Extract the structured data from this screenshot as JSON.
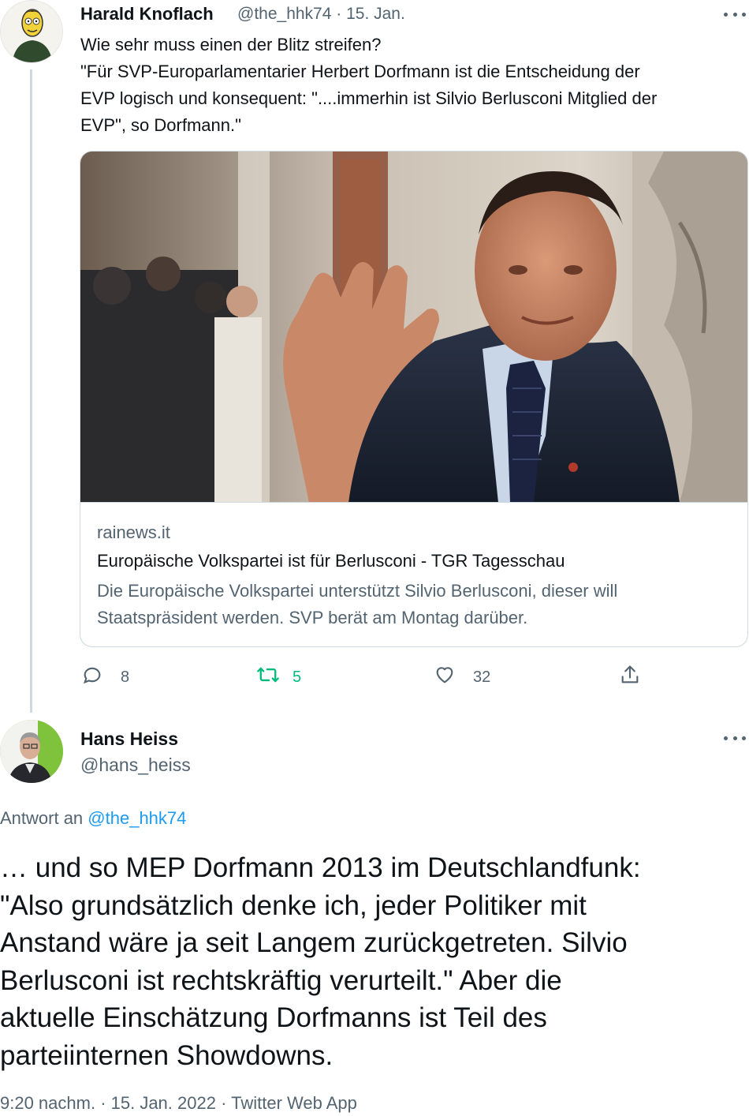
{
  "tweet1": {
    "author_name": "Harald Knoflach",
    "author_handle": "@the_hhk74",
    "date": "15. Jan.",
    "text_lines": [
      "Wie sehr muss einen der Blitz streifen?",
      "\"Für SVP-Europarlamentarier Herbert Dorfmann ist die Entscheidung der",
      "EVP logisch und konsequent: \"....immerhin ist Silvio Berlusconi Mitglied der",
      "EVP\", so Dorfmann.\""
    ],
    "card": {
      "domain": "rainews.it",
      "title": "Europäische Volkspartei ist für Berlusconi - TGR Tagesschau",
      "description_lines": [
        "Die Europäische Volkspartei unterstützt Silvio Berlusconi, dieser will",
        "Staatspräsident werden. SVP berät am Montag darüber."
      ]
    },
    "actions": {
      "replies": "8",
      "retweets": "5",
      "likes": "32"
    }
  },
  "tweet2": {
    "author_name": "Hans Heiss",
    "author_handle": "@hans_heiss",
    "reply_prefix": "Antwort an",
    "reply_handle": "@the_hhk74",
    "text_lines": [
      "… und so MEP Dorfmann 2013 im Deutschlandfunk:",
      "\"Also grundsätzlich denke ich, jeder Politiker mit",
      "Anstand wäre ja seit Langem zurückgetreten. Silvio",
      "Berlusconi ist rechtskräftig verurteilt.\" Aber die",
      "aktuelle Einschätzung Dorfmanns ist Teil des",
      "parteiinternen Showdowns."
    ],
    "meta": "9:20 nachm. · 15. Jan. 2022 · Twitter Web App"
  },
  "colors": {
    "text_primary": "#0f1419",
    "text_secondary": "#536471",
    "link": "#1d9bf0",
    "retweet": "#00ba7c",
    "border": "#cfd9de"
  },
  "icons": {
    "reply": "reply-icon",
    "retweet": "retweet-icon",
    "like": "heart-icon",
    "share": "share-icon",
    "more": "more-icon"
  }
}
